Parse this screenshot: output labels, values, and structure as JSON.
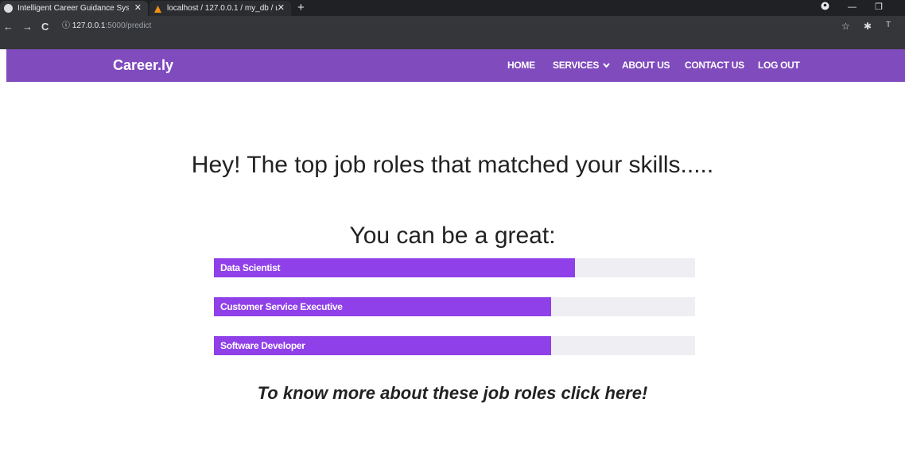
{
  "browser": {
    "tabs": [
      {
        "title": "Intelligent Career Guidance Syste",
        "close": "✕"
      },
      {
        "title": "localhost / 127.0.0.1 / my_db / us",
        "close": "✕"
      }
    ],
    "new_tab": "+",
    "url_host": "127.0.0.1",
    "url_path": ":5000/predict",
    "profile_initial": "T"
  },
  "site": {
    "brand": "Career.ly",
    "nav": [
      "HOME",
      "SERVICES",
      "ABOUT US",
      "CONTACT US",
      "LOG OUT"
    ],
    "services_caret": "⌄"
  },
  "main": {
    "heading": "Hey! The top job roles that matched your skills.....",
    "subheading": "You can be a great:",
    "roles": [
      {
        "label": "Data Scientist",
        "fraction": 0.75
      },
      {
        "label": "Customer Service Executive",
        "fraction": 0.7
      },
      {
        "label": "Software Developer",
        "fraction": 0.7
      }
    ],
    "cta": "To know more about these job roles click here!"
  },
  "colors": {
    "navbar": "#7f4bbd",
    "bar_fill": "#9040e8",
    "bar_track": "#efeef2"
  }
}
